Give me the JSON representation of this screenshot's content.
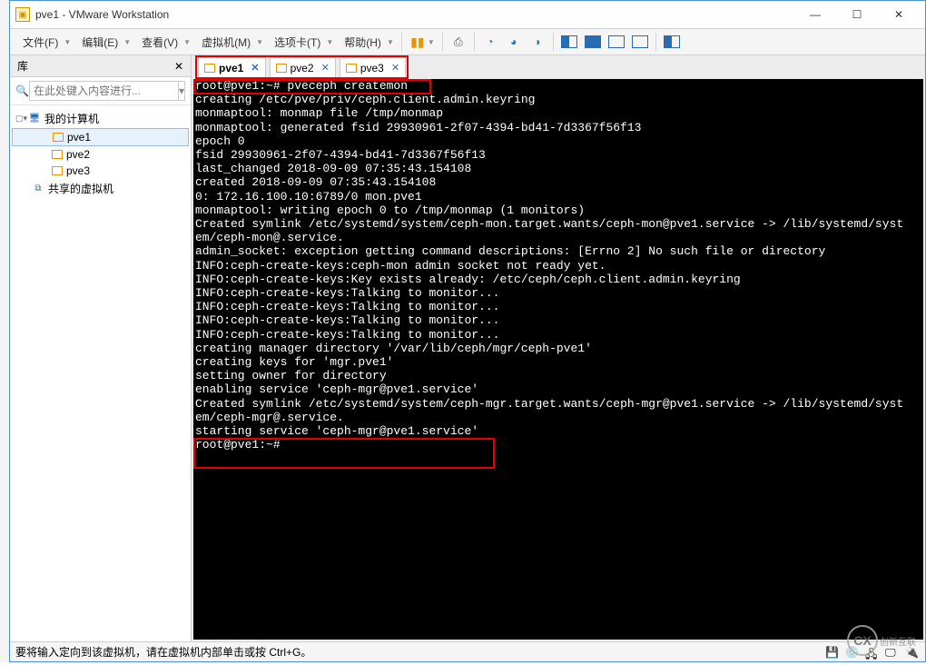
{
  "titlebar": {
    "title": "pve1 - VMware Workstation"
  },
  "menu": {
    "file": "文件(F)",
    "edit": "编辑(E)",
    "view": "查看(V)",
    "vm": "虚拟机(M)",
    "tabs": "选项卡(T)",
    "help": "帮助(H)"
  },
  "sidebar": {
    "header": "库",
    "search_placeholder": "在此处键入内容进行...",
    "root": "我的计算机",
    "items": [
      "pve1",
      "pve2",
      "pve3"
    ],
    "shared": "共享的虚拟机"
  },
  "vm_tabs": [
    {
      "label": "pve1",
      "active": true
    },
    {
      "label": "pve2",
      "active": false
    },
    {
      "label": "pve3",
      "active": false
    }
  ],
  "console": {
    "prompt1": "root@pve1:~# pveceph createmon",
    "lines": [
      "creating /etc/pve/priv/ceph.client.admin.keyring",
      "monmaptool: monmap file /tmp/monmap",
      "monmaptool: generated fsid 29930961-2f07-4394-bd41-7d3367f56f13",
      "epoch 0",
      "fsid 29930961-2f07-4394-bd41-7d3367f56f13",
      "last_changed 2018-09-09 07:35:43.154108",
      "created 2018-09-09 07:35:43.154108",
      "0: 172.16.100.10:6789/0 mon.pve1",
      "monmaptool: writing epoch 0 to /tmp/monmap (1 monitors)",
      "Created symlink /etc/systemd/system/ceph-mon.target.wants/ceph-mon@pve1.service -> /lib/systemd/syst",
      "em/ceph-mon@.service.",
      "admin_socket: exception getting command descriptions: [Errno 2] No such file or directory",
      "INFO:ceph-create-keys:ceph-mon admin socket not ready yet.",
      "INFO:ceph-create-keys:Key exists already: /etc/ceph/ceph.client.admin.keyring",
      "INFO:ceph-create-keys:Talking to monitor...",
      "INFO:ceph-create-keys:Talking to monitor...",
      "INFO:ceph-create-keys:Talking to monitor...",
      "INFO:ceph-create-keys:Talking to monitor...",
      "creating manager directory '/var/lib/ceph/mgr/ceph-pve1'",
      "creating keys for 'mgr.pve1'",
      "setting owner for directory",
      "enabling service 'ceph-mgr@pve1.service'",
      "Created symlink /etc/systemd/system/ceph-mgr.target.wants/ceph-mgr@pve1.service -> /lib/systemd/syst",
      "em/ceph-mgr@.service."
    ],
    "tail": [
      "starting service 'ceph-mgr@pve1.service'",
      "root@pve1:~#"
    ]
  },
  "status": {
    "hint": "要将输入定向到该虚拟机，请在虚拟机内部单击或按 Ctrl+G。"
  },
  "watermark": "创新互联"
}
